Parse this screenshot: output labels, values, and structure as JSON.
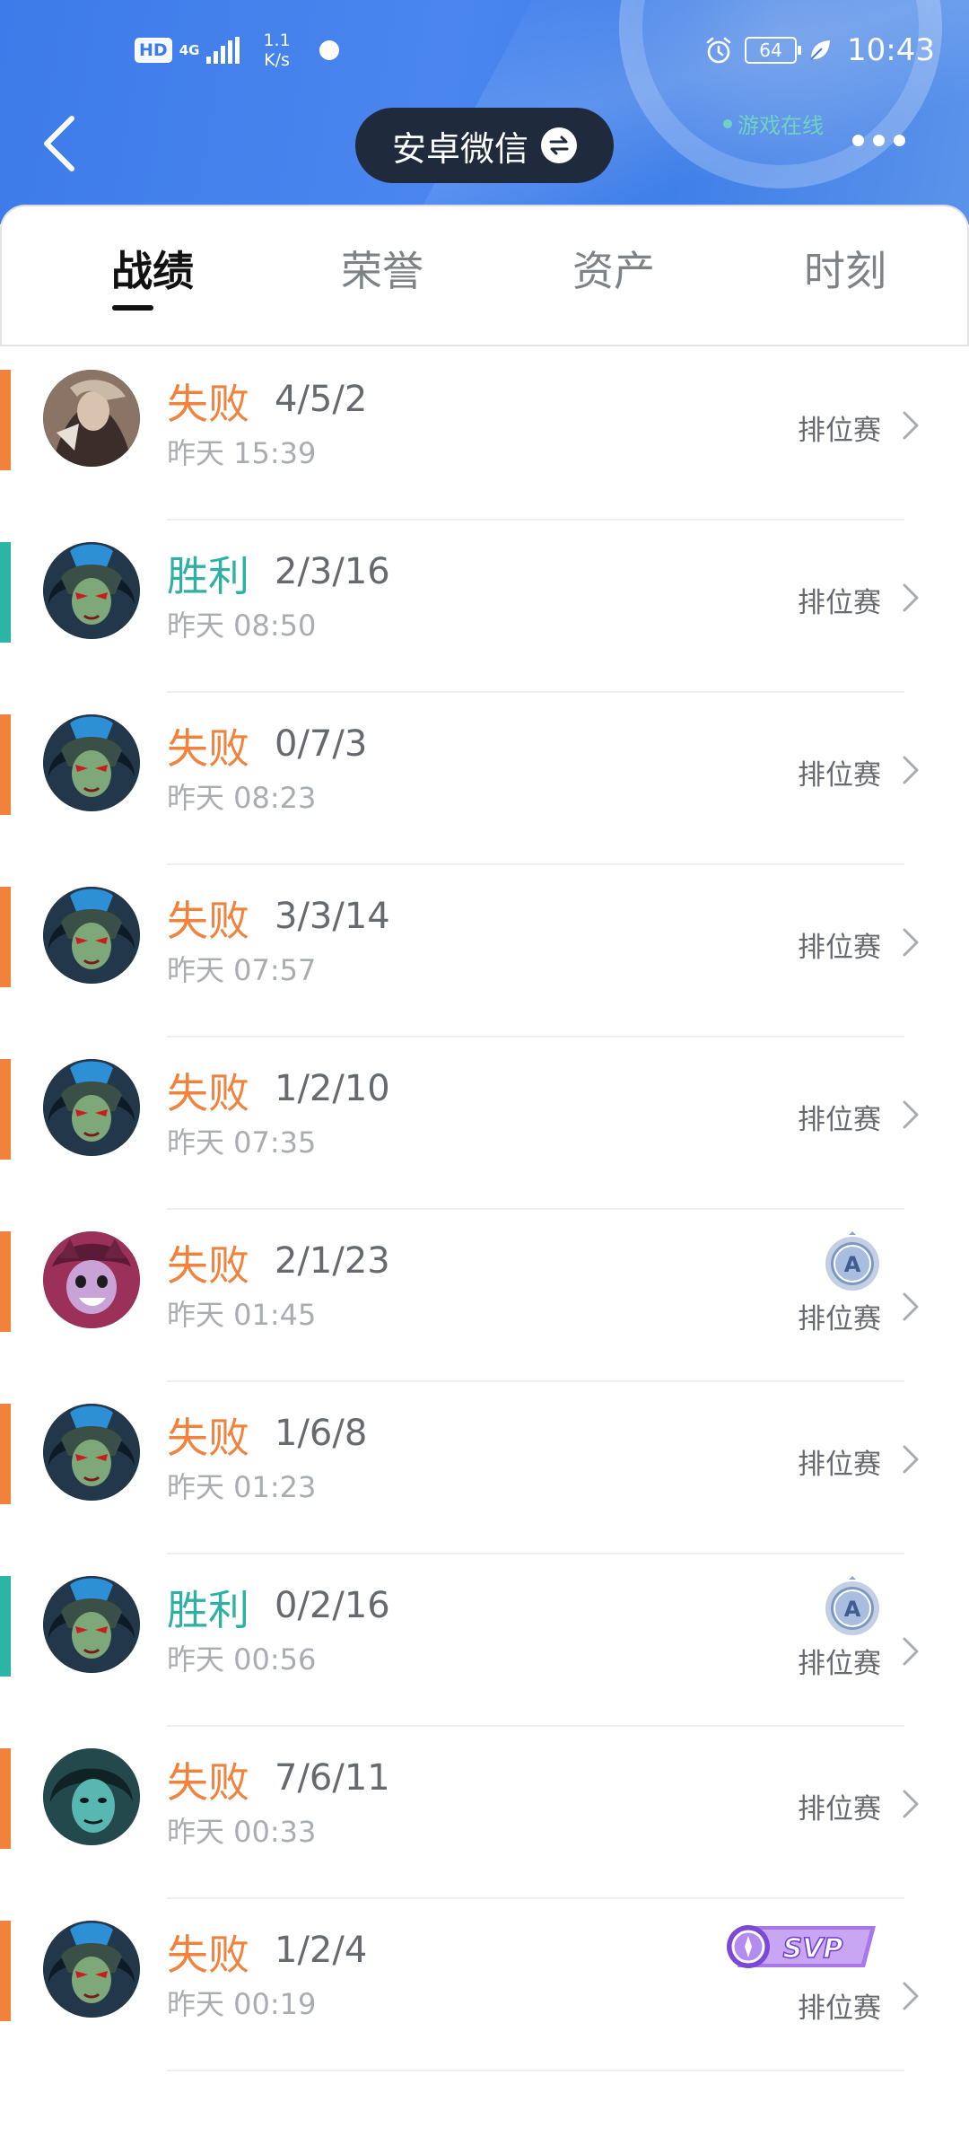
{
  "status_bar": {
    "hd": "HD",
    "network": "4G",
    "speed_value": "1.1",
    "speed_unit": "K/s",
    "battery": "64",
    "time": "10:43"
  },
  "header": {
    "account_name": "安卓微信",
    "online_status": "游戏在线"
  },
  "tabs": [
    {
      "label": "战绩",
      "active": true
    },
    {
      "label": "荣誉",
      "active": false
    },
    {
      "label": "资产",
      "active": false
    },
    {
      "label": "时刻",
      "active": false
    }
  ],
  "colors": {
    "lose": "#f0823b",
    "win": "#2bb5a5",
    "header_blue": "#3d7bea"
  },
  "matches": [
    {
      "result": "失败",
      "outcome": "lose",
      "kda": "4/5/2",
      "time": "昨天 15:39",
      "mode": "排位赛",
      "hero_icon": "hero-avatar-armored-warrior",
      "badge": null
    },
    {
      "result": "胜利",
      "outcome": "win",
      "kda": "2/3/16",
      "time": "昨天 08:50",
      "mode": "排位赛",
      "hero_icon": "hero-avatar-masked-green",
      "badge": null
    },
    {
      "result": "失败",
      "outcome": "lose",
      "kda": "0/7/3",
      "time": "昨天 08:23",
      "mode": "排位赛",
      "hero_icon": "hero-avatar-masked-green",
      "badge": null
    },
    {
      "result": "失败",
      "outcome": "lose",
      "kda": "3/3/14",
      "time": "昨天 07:57",
      "mode": "排位赛",
      "hero_icon": "hero-avatar-masked-green",
      "badge": null
    },
    {
      "result": "失败",
      "outcome": "lose",
      "kda": "1/2/10",
      "time": "昨天 07:35",
      "mode": "排位赛",
      "hero_icon": "hero-avatar-masked-green",
      "badge": null
    },
    {
      "result": "失败",
      "outcome": "lose",
      "kda": "2/1/23",
      "time": "昨天 01:45",
      "mode": "排位赛",
      "hero_icon": "hero-avatar-pink-girl",
      "badge": "A"
    },
    {
      "result": "失败",
      "outcome": "lose",
      "kda": "1/6/8",
      "time": "昨天 01:23",
      "mode": "排位赛",
      "hero_icon": "hero-avatar-masked-green",
      "badge": null
    },
    {
      "result": "胜利",
      "outcome": "win",
      "kda": "0/2/16",
      "time": "昨天 00:56",
      "mode": "排位赛",
      "hero_icon": "hero-avatar-masked-green",
      "badge": "A"
    },
    {
      "result": "失败",
      "outcome": "lose",
      "kda": "7/6/11",
      "time": "昨天 00:33",
      "mode": "排位赛",
      "hero_icon": "hero-avatar-teal-warrior",
      "badge": null
    },
    {
      "result": "失败",
      "outcome": "lose",
      "kda": "1/2/4",
      "time": "昨天 00:19",
      "mode": "排位赛",
      "hero_icon": "hero-avatar-masked-green",
      "badge": "SVP"
    }
  ]
}
